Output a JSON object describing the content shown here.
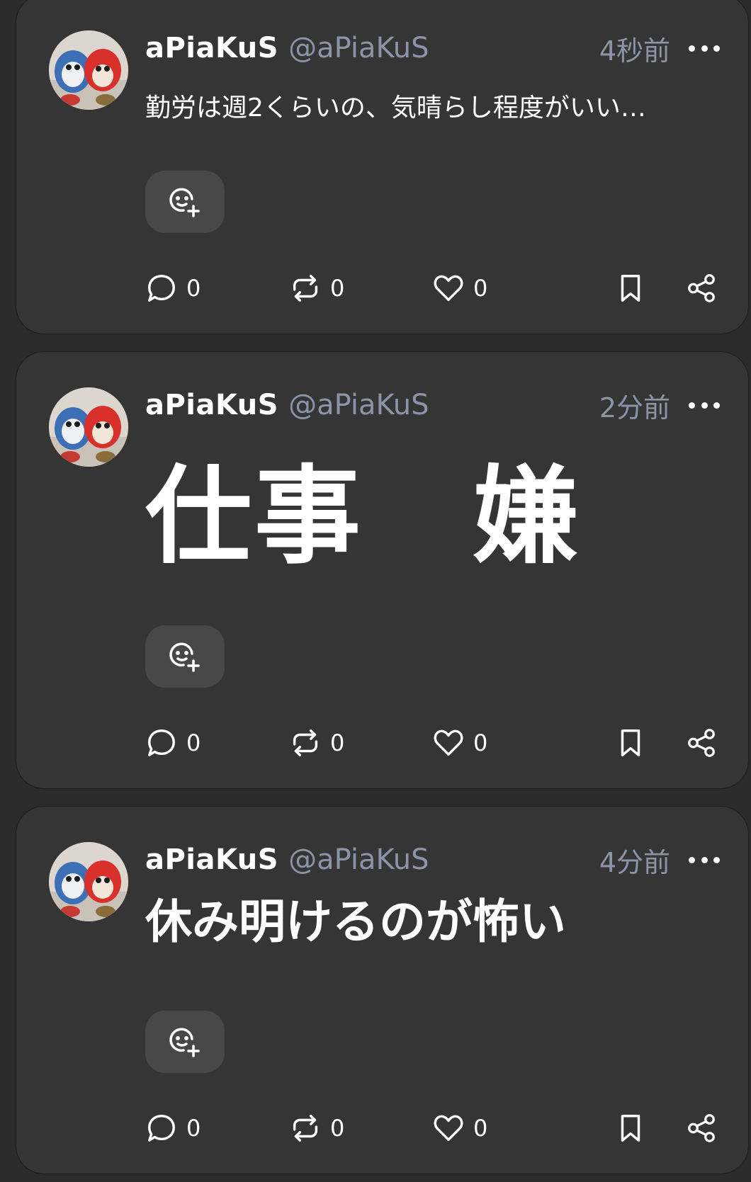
{
  "posts": [
    {
      "name": "aPiaKuS",
      "handle": "@aPiaKuS",
      "time": "4秒前",
      "text": "勤労は週2くらいの、気晴らし程度がいい…",
      "replies": "0",
      "renotes": "0",
      "likes": "0"
    },
    {
      "name": "aPiaKuS",
      "handle": "@aPiaKuS",
      "time": "2分前",
      "text": "仕事　嫌",
      "replies": "0",
      "renotes": "0",
      "likes": "0"
    },
    {
      "name": "aPiaKuS",
      "handle": "@aPiaKuS",
      "time": "4分前",
      "text": "休み明けるのが怖い",
      "replies": "0",
      "renotes": "0",
      "likes": "0"
    }
  ],
  "icons": {
    "avatar": "plush-toys-avatar",
    "more": "more-horizontal-icon",
    "reaction": "emoji-add-icon",
    "reply": "reply-bubble-icon",
    "renote": "repost-icon",
    "like": "heart-icon",
    "bookmark": "bookmark-icon",
    "share": "share-icon"
  },
  "colors": {
    "background": "#2b2b2b",
    "card": "#353535",
    "handle": "#8e94a8",
    "reaction_button": "#484848",
    "text": "#ffffff"
  }
}
